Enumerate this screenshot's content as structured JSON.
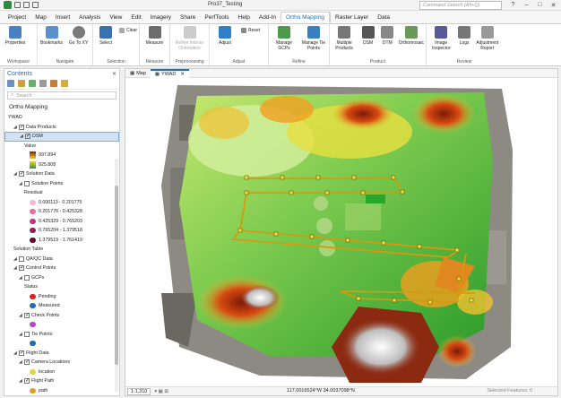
{
  "app": {
    "title": "Pro37_Testing",
    "command_search": "Command Search (Alt+Q)"
  },
  "menu": {
    "tabs": [
      "Project",
      "Map",
      "Insert",
      "Analysis",
      "View",
      "Edit",
      "Imagery",
      "Share",
      "PerfTools",
      "Help",
      "Add-In"
    ],
    "active_tab": "Ortho Mapping",
    "context_tabs": [
      "Raster Layer",
      "Data"
    ]
  },
  "ribbon": {
    "workspace": {
      "label": "Workspace",
      "properties": "Properties"
    },
    "navigate": {
      "label": "Navigate",
      "bookmarks": "Bookmarks",
      "goto": "Go To XY"
    },
    "selection": {
      "label": "Selection",
      "select": "Select",
      "clear": "Clear"
    },
    "measure": {
      "label": "Measure",
      "measure": "Measure"
    },
    "preprocessing": {
      "label": "Preprocessing",
      "refine": "Refine Interior Orientation"
    },
    "adjust": {
      "label": "Adjust",
      "adjust": "Adjust",
      "reset": "Reset"
    },
    "refine": {
      "label": "Refine",
      "manage_gcps": "Manage GCPs",
      "manage_tie": "Manage Tie Points"
    },
    "product": {
      "label": "Product",
      "multiple": "Multiple Products",
      "dsm": "DSM",
      "dtm": "DTM",
      "ortho": "Orthomosaic"
    },
    "review": {
      "label": "Review",
      "image_inspector": "Image Inspector",
      "logs": "Logs",
      "adj_report": "Adjustment Report"
    }
  },
  "contents": {
    "header": "Contents",
    "search_placeholder": "Search",
    "section_title": "Ortho Mapping",
    "tree": [
      {
        "label": "YWAD",
        "indent": 0,
        "icon": "workspace"
      },
      {
        "label": "Data Products",
        "indent": 1,
        "check": true
      },
      {
        "label": "DSM",
        "indent": 2,
        "check": true,
        "selected": true
      },
      {
        "label": "Value",
        "indent": 3
      },
      {
        "label": "997.894",
        "indent": 4,
        "ramp": "top"
      },
      {
        "label": "925.808",
        "indent": 4,
        "ramp": "bottom"
      },
      {
        "label": "Solution Data",
        "indent": 1,
        "check": true
      },
      {
        "label": "Solution Points",
        "indent": 2,
        "check": false
      },
      {
        "label": "Residual",
        "indent": 3
      },
      {
        "label": "0.000113 - 0.201775",
        "indent": 4,
        "swatch": "#f7b6d0"
      },
      {
        "label": "0.201776 - 0.425328",
        "indent": 4,
        "swatch": "#e96aa3"
      },
      {
        "label": "0.425329 - 0.765203",
        "indent": 4,
        "swatch": "#c8327c"
      },
      {
        "label": "0.765204 - 1.379518",
        "indent": 4,
        "swatch": "#9a1a55"
      },
      {
        "label": "1.379519 - 1.761419",
        "indent": 4,
        "swatch": "#5e0b2f"
      },
      {
        "label": "Solution Table",
        "indent": 1
      },
      {
        "label": "QA/QC Data",
        "indent": 1,
        "check": false
      },
      {
        "label": "Control Points",
        "indent": 1,
        "check": true
      },
      {
        "label": "GCPs",
        "indent": 2,
        "check": false
      },
      {
        "label": "Status",
        "indent": 3
      },
      {
        "label": "Pending",
        "indent": 4,
        "swatch": "#e02020"
      },
      {
        "label": "Measured",
        "indent": 4,
        "swatch": "#1d6fb8"
      },
      {
        "label": "Check Points",
        "indent": 2,
        "check": true
      },
      {
        "label": "",
        "indent": 4,
        "swatch": "#c13fd1"
      },
      {
        "label": "Tie Points",
        "indent": 2,
        "check": false
      },
      {
        "label": "",
        "indent": 4,
        "swatch": "#1d6fb8"
      },
      {
        "label": "Flight Data",
        "indent": 1,
        "check": true
      },
      {
        "label": "Camera Locations",
        "indent": 2,
        "check": true
      },
      {
        "label": "location",
        "indent": 4,
        "swatch": "#e8d24a"
      },
      {
        "label": "Flight Path",
        "indent": 2,
        "check": true
      },
      {
        "label": "path",
        "indent": 4,
        "swatch": "#e0a020"
      }
    ]
  },
  "map": {
    "tabs": [
      "Map",
      "YWAD"
    ],
    "active_tab": "YWAD",
    "scale": "1:1,310",
    "coordinates": "117.0016524°W 34.0037098°N",
    "selected_features": "Selected Features: 0",
    "colors": {
      "high": "#8b1a0a",
      "mid": "#f0d030",
      "low": "#2a9a2a",
      "snow": "#f5f5f5"
    }
  }
}
